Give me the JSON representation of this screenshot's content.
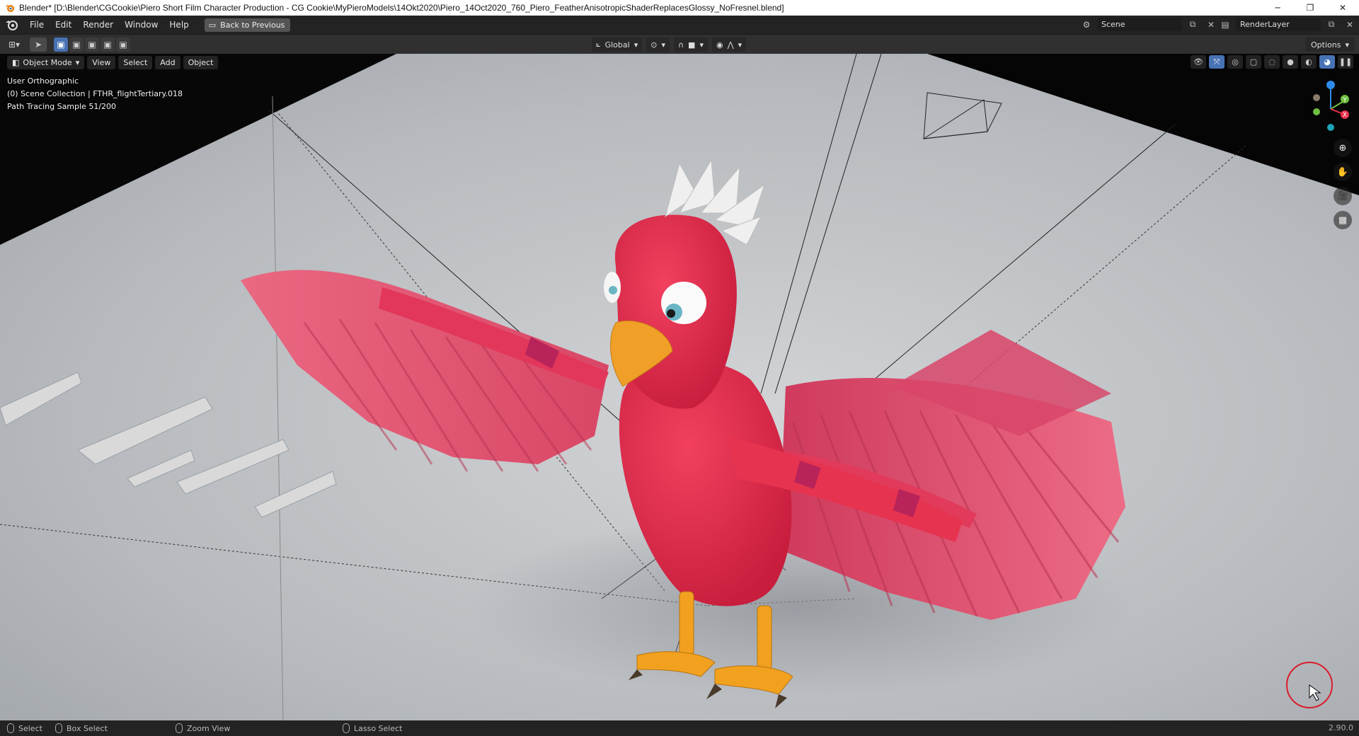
{
  "window": {
    "title": "Blender* [D:\\Blender\\CGCookie\\Piero Short Film Character Production - CG Cookie\\MyPieroModels\\14Okt2020\\Piero_14Oct2020_760_Piero_FeatherAnisotropicShaderReplacesGlossy_NoFresnel.blend]",
    "controls": {
      "minimize": "─",
      "restore": "❐",
      "close": "✕"
    }
  },
  "topbar": {
    "menus": [
      "File",
      "Edit",
      "Render",
      "Window",
      "Help"
    ],
    "back_button": "Back to Previous",
    "scene": "Scene",
    "render_layer": "RenderLayer"
  },
  "toolheader": {
    "transform_orientation": "Global",
    "options": "Options"
  },
  "viewport": {
    "header": {
      "mode": "Object Mode",
      "menus": [
        "View",
        "Select",
        "Add",
        "Object"
      ]
    },
    "info": {
      "view_name": "User Orthographic",
      "collection": "(0) Scene Collection | FTHR_flightTertiary.018",
      "render_status": "Path Tracing Sample 51/200"
    },
    "gizmo_axes": [
      "Y",
      "X"
    ]
  },
  "statusbar": {
    "items": [
      {
        "label": "Select"
      },
      {
        "label": "Box Select"
      },
      {
        "label": "Zoom View"
      },
      {
        "label": "Lasso Select"
      }
    ],
    "version": "2.90.0"
  },
  "colors": {
    "accent": "#4772b3",
    "bird_body": "#e8294a",
    "wing": "#e65a78",
    "beak": "#f0a028",
    "cursor_circle": "#d81e2c"
  }
}
